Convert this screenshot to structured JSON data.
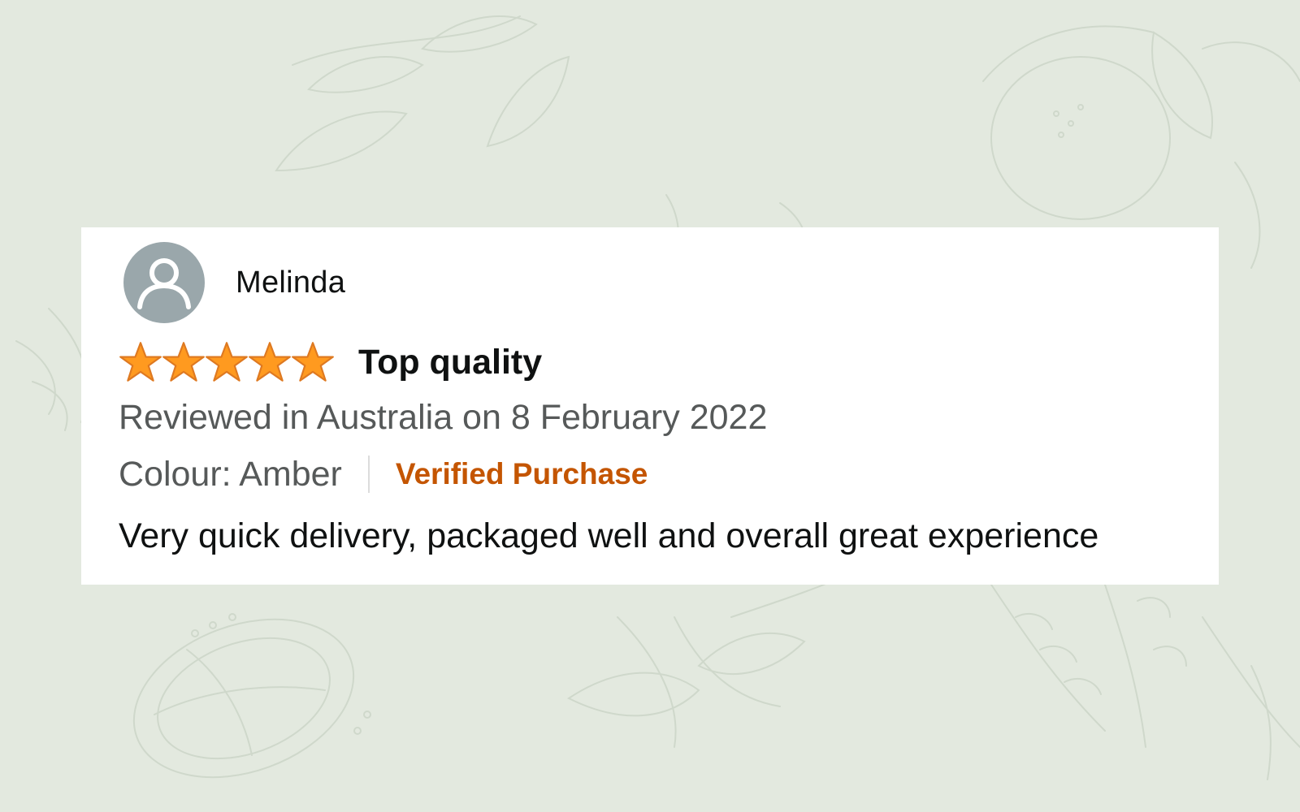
{
  "review": {
    "reviewer_name": "Melinda",
    "avatar_icon": "user-silhouette-icon",
    "rating": 5,
    "rating_max": 5,
    "star_color": "#ff9a1f",
    "title": "Top quality",
    "date_text": "Reviewed in Australia on 8 February 2022",
    "colour_text": "Colour: Amber",
    "verified_text": "Verified Purchase",
    "verified_color": "#c45500",
    "body": "Very quick delivery, packaged well and overall great experience"
  },
  "colors": {
    "background": "#e3e9df",
    "card": "#ffffff",
    "text_primary": "#0f1111",
    "text_secondary": "#565959"
  }
}
